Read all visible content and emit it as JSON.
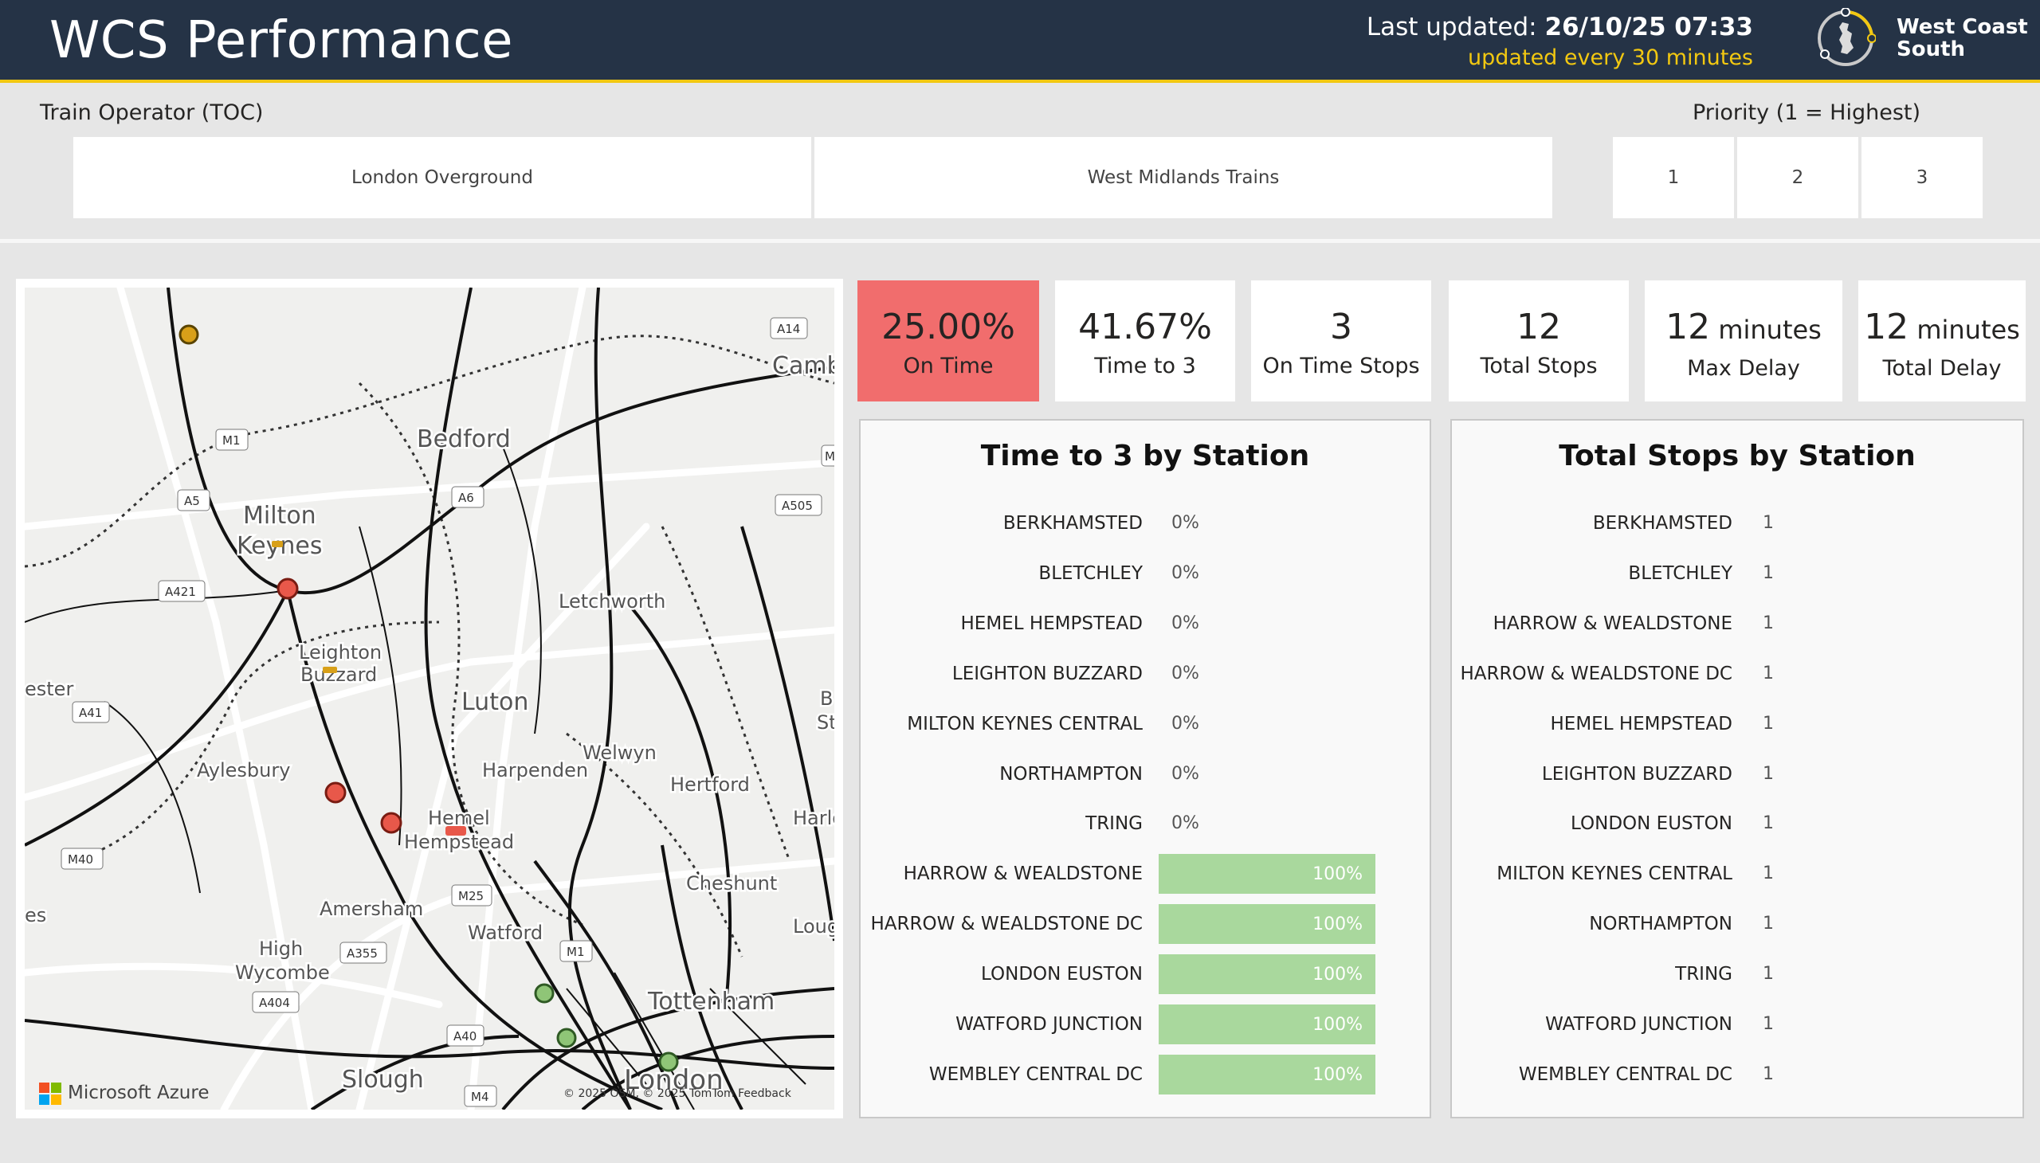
{
  "header": {
    "title": "WCS Performance",
    "last_updated_label": "Last updated:",
    "last_updated_value": "26/10/25 07:33",
    "update_frequency": "updated every 30 minutes",
    "logo_text_line1": "West Coast",
    "logo_text_line2": "South"
  },
  "toc_slicer": {
    "title": "Train Operator (TOC)",
    "options": [
      "London Overground",
      "West Midlands Trains"
    ]
  },
  "priority_slicer": {
    "title": "Priority (1 = Highest)",
    "options": [
      "1",
      "2",
      "3"
    ]
  },
  "map": {
    "place_labels": [
      "Bedford",
      "Milton",
      "Keynes",
      "Cambr",
      "Leighton",
      "Buzzard",
      "Letchworth",
      "Luton",
      "Aylesbury",
      "Harpenden",
      "Welwyn",
      "Hertford",
      "Hemel",
      "Hempstead",
      "Amersham",
      "Watford",
      "Cheshunt",
      "High",
      "Wycombe",
      "Tottenham",
      "Slough",
      "London",
      "ester",
      "es",
      "Harlo",
      "Loughton",
      "B",
      "St"
    ],
    "road_labels": [
      "M1",
      "A5",
      "A421",
      "A41",
      "M40",
      "A6",
      "A14",
      "A505",
      "M25",
      "A355",
      "A404",
      "A40",
      "M4",
      "M1",
      "A4",
      "M"
    ],
    "attribution_brand": "Microsoft Azure",
    "attribution_text": "© 2025 OSM, © 2025 TomTom  Feedback",
    "marker_colors": {
      "late": "#e8584a",
      "ontime": "#8fc577",
      "amber": "#d8a019"
    }
  },
  "kpis": [
    {
      "value": "25.00%",
      "unit": "",
      "label": "On Time"
    },
    {
      "value": "41.67%",
      "unit": "",
      "label": "Time to 3"
    },
    {
      "value": "3",
      "unit": "",
      "label": "On Time Stops"
    },
    {
      "value": "12",
      "unit": "",
      "label": "Total Stops"
    },
    {
      "value": "12",
      "unit": " minutes",
      "label": "Max Delay"
    },
    {
      "value": "12",
      "unit": " minutes",
      "label": "Total Delay"
    }
  ],
  "time_to_3_table": {
    "title": "Time to 3 by Station",
    "rows": [
      {
        "station": "BERKHAMSTED",
        "value": "0%",
        "fraction": 0
      },
      {
        "station": "BLETCHLEY",
        "value": "0%",
        "fraction": 0
      },
      {
        "station": "HEMEL HEMPSTEAD",
        "value": "0%",
        "fraction": 0
      },
      {
        "station": "LEIGHTON BUZZARD",
        "value": "0%",
        "fraction": 0
      },
      {
        "station": "MILTON KEYNES CENTRAL",
        "value": "0%",
        "fraction": 0
      },
      {
        "station": "NORTHAMPTON",
        "value": "0%",
        "fraction": 0
      },
      {
        "station": "TRING",
        "value": "0%",
        "fraction": 0
      },
      {
        "station": "HARROW & WEALDSTONE",
        "value": "100%",
        "fraction": 1
      },
      {
        "station": "HARROW & WEALDSTONE DC",
        "value": "100%",
        "fraction": 1
      },
      {
        "station": "LONDON EUSTON",
        "value": "100%",
        "fraction": 1
      },
      {
        "station": "WATFORD JUNCTION",
        "value": "100%",
        "fraction": 1
      },
      {
        "station": "WEMBLEY CENTRAL DC",
        "value": "100%",
        "fraction": 1
      }
    ]
  },
  "total_stops_table": {
    "title": "Total Stops by Station",
    "rows": [
      {
        "station": "BERKHAMSTED",
        "value": "1"
      },
      {
        "station": "BLETCHLEY",
        "value": "1"
      },
      {
        "station": "HARROW & WEALDSTONE",
        "value": "1"
      },
      {
        "station": "HARROW & WEALDSTONE DC",
        "value": "1"
      },
      {
        "station": "HEMEL HEMPSTEAD",
        "value": "1"
      },
      {
        "station": "LEIGHTON BUZZARD",
        "value": "1"
      },
      {
        "station": "LONDON EUSTON",
        "value": "1"
      },
      {
        "station": "MILTON KEYNES CENTRAL",
        "value": "1"
      },
      {
        "station": "NORTHAMPTON",
        "value": "1"
      },
      {
        "station": "TRING",
        "value": "1"
      },
      {
        "station": "WATFORD JUNCTION",
        "value": "1"
      },
      {
        "station": "WEMBLEY CENTRAL DC",
        "value": "1"
      }
    ]
  },
  "colors": {
    "header_bg": "#253346",
    "accent_yellow": "#f2c811",
    "alert_red": "#f16d6d",
    "bar_green": "#a9d89d"
  }
}
